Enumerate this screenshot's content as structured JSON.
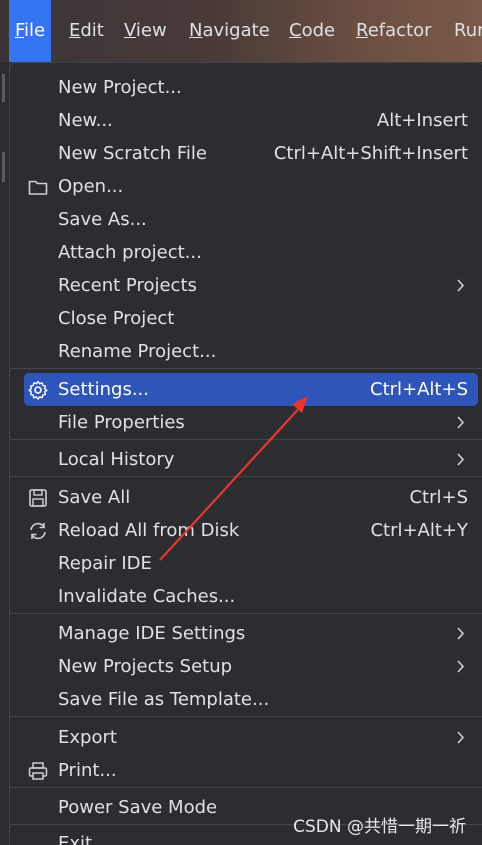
{
  "menubar": {
    "items": [
      {
        "label": "File",
        "mnemonic": "F",
        "rest": "ile"
      },
      {
        "label": "Edit",
        "mnemonic": "E",
        "rest": "dit"
      },
      {
        "label": "View",
        "mnemonic": "V",
        "rest": "iew"
      },
      {
        "label": "Navigate",
        "mnemonic": "N",
        "rest": "avigate"
      },
      {
        "label": "Code",
        "mnemonic": "C",
        "rest": "ode"
      },
      {
        "label": "Refactor",
        "mnemonic": "R",
        "rest": "efactor"
      },
      {
        "label": "Run",
        "mnemonic": "",
        "rest": "Rur"
      }
    ]
  },
  "file_menu": {
    "items": [
      {
        "label": "New Project...",
        "shortcut": ""
      },
      {
        "label": "New...",
        "shortcut": "Alt+Insert"
      },
      {
        "label": "New Scratch File",
        "shortcut": "Ctrl+Alt+Shift+Insert"
      },
      {
        "label": "Open...",
        "shortcut": "",
        "icon": "folder-icon"
      },
      {
        "label": "Save As...",
        "shortcut": ""
      },
      {
        "label": "Attach project...",
        "shortcut": ""
      },
      {
        "label": "Recent Projects",
        "shortcut": "",
        "submenu": true
      },
      {
        "label": "Close Project",
        "shortcut": ""
      },
      {
        "label": "Rename Project...",
        "shortcut": ""
      },
      {
        "label": "Settings...",
        "shortcut": "Ctrl+Alt+S",
        "icon": "gear-icon",
        "selected": true
      },
      {
        "label": "File Properties",
        "shortcut": "",
        "submenu": true
      },
      {
        "label": "Local History",
        "shortcut": "",
        "submenu": true
      },
      {
        "label": "Save All",
        "shortcut": "Ctrl+S",
        "icon": "save-icon"
      },
      {
        "label": "Reload All from Disk",
        "shortcut": "Ctrl+Alt+Y",
        "icon": "reload-icon"
      },
      {
        "label": "Repair IDE",
        "shortcut": ""
      },
      {
        "label": "Invalidate Caches...",
        "shortcut": ""
      },
      {
        "label": "Manage IDE Settings",
        "shortcut": "",
        "submenu": true
      },
      {
        "label": "New Projects Setup",
        "shortcut": "",
        "submenu": true
      },
      {
        "label": "Save File as Template...",
        "shortcut": ""
      },
      {
        "label": "Export",
        "shortcut": "",
        "submenu": true
      },
      {
        "label": "Print...",
        "shortcut": "",
        "icon": "printer-icon"
      },
      {
        "label": "Power Save Mode",
        "shortcut": ""
      },
      {
        "label": "Exit",
        "shortcut": ""
      }
    ]
  },
  "watermark": "CSDN @共惜一期一祈",
  "colors": {
    "selection": "#2e55b9",
    "active_menu": "#3574f0",
    "annotation_arrow": "#e8362b"
  }
}
